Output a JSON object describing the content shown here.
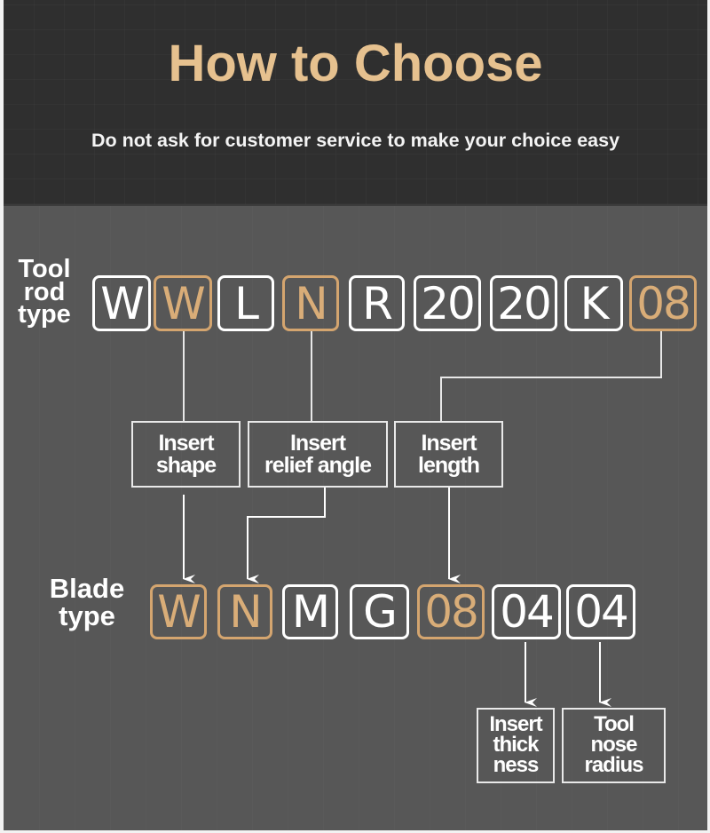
{
  "header": {
    "title": "How to Choose",
    "subtitle": "Do not ask for customer service to make your choice easy"
  },
  "colors": {
    "accent": "#d9ad78",
    "title": "#e6c18f",
    "header_bg": "#2f2f2f",
    "body_bg": "#575757",
    "line": "#ffffff"
  },
  "tool_rod": {
    "label_lines": [
      "Tool",
      "rod",
      "type"
    ],
    "codes": [
      {
        "text": "W",
        "highlighted": false
      },
      {
        "text": "W",
        "highlighted": true
      },
      {
        "text": "L",
        "highlighted": false
      },
      {
        "text": "N",
        "highlighted": true
      },
      {
        "text": "R",
        "highlighted": false
      },
      {
        "text": "20",
        "highlighted": false
      },
      {
        "text": "20",
        "highlighted": false
      },
      {
        "text": "K",
        "highlighted": false
      },
      {
        "text": "08",
        "highlighted": true
      }
    ]
  },
  "middle_labels": [
    {
      "lines": [
        "Insert",
        "shape"
      ]
    },
    {
      "lines": [
        "Insert",
        "relief angle"
      ]
    },
    {
      "lines": [
        "Insert",
        "length"
      ]
    }
  ],
  "blade": {
    "label_lines": [
      "Blade",
      "type"
    ],
    "codes": [
      {
        "text": "W",
        "highlighted": true
      },
      {
        "text": "N",
        "highlighted": true
      },
      {
        "text": "M",
        "highlighted": false
      },
      {
        "text": "G",
        "highlighted": false
      },
      {
        "text": "08",
        "highlighted": true
      },
      {
        "text": "04",
        "highlighted": false
      },
      {
        "text": "04",
        "highlighted": false
      }
    ]
  },
  "bottom_labels": [
    {
      "lines": [
        "Insert",
        "thick",
        "ness"
      ]
    },
    {
      "lines": [
        "Tool",
        "nose",
        "radius"
      ]
    }
  ],
  "mappings": [
    {
      "from": "tool_rod.codes.1",
      "label": "middle_labels.0",
      "to": "blade.codes.0"
    },
    {
      "from": "tool_rod.codes.3",
      "label": "middle_labels.1",
      "to": "blade.codes.1"
    },
    {
      "from": "tool_rod.codes.8",
      "label": "middle_labels.2",
      "to": "blade.codes.4"
    },
    {
      "from": "blade.codes.5",
      "label": "bottom_labels.0"
    },
    {
      "from": "blade.codes.6",
      "label": "bottom_labels.1"
    }
  ]
}
